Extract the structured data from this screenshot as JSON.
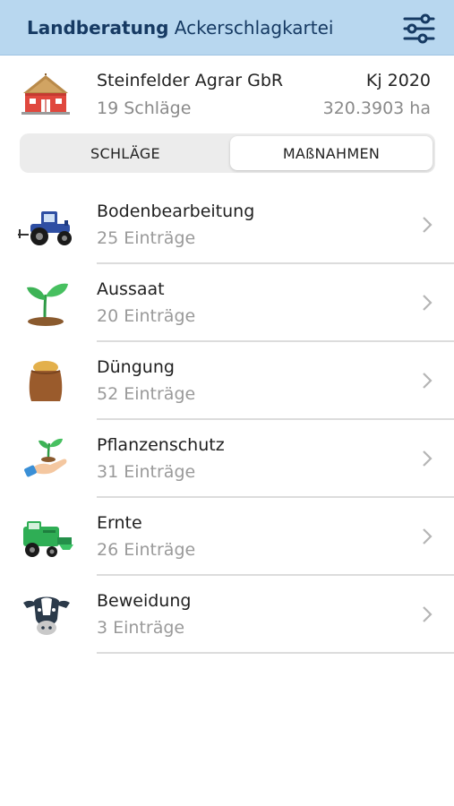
{
  "app_bar": {
    "brand": "Landberatung",
    "title": "Ackerschlagkartei",
    "filter_icon": "sliders-icon",
    "color": "#b8d7ef"
  },
  "farm": {
    "icon": "farm-barn-icon",
    "name": "Steinfelder Agrar GbR",
    "fields_count": "19 Schläge",
    "year": "Kj 2020",
    "area": "320.3903 ha"
  },
  "tabs": [
    {
      "label": "SCHLÄGE",
      "selected": false
    },
    {
      "label": "MAßNAHMEN",
      "selected": true
    }
  ],
  "categories": [
    {
      "icon": "tractor-icon",
      "title": "Bodenbearbeitung",
      "entries": "25 Einträge"
    },
    {
      "icon": "seedling-icon",
      "title": "Aussaat",
      "entries": "20 Einträge"
    },
    {
      "icon": "fertilizer-sack-icon",
      "title": "Düngung",
      "entries": "52 Einträge"
    },
    {
      "icon": "plant-in-hand-icon",
      "title": "Pflanzenschutz",
      "entries": "31 Einträge"
    },
    {
      "icon": "combine-harvester-icon",
      "title": "Ernte",
      "entries": "26 Einträge"
    },
    {
      "icon": "cow-icon",
      "title": "Beweidung",
      "entries": "3 Einträge"
    }
  ]
}
